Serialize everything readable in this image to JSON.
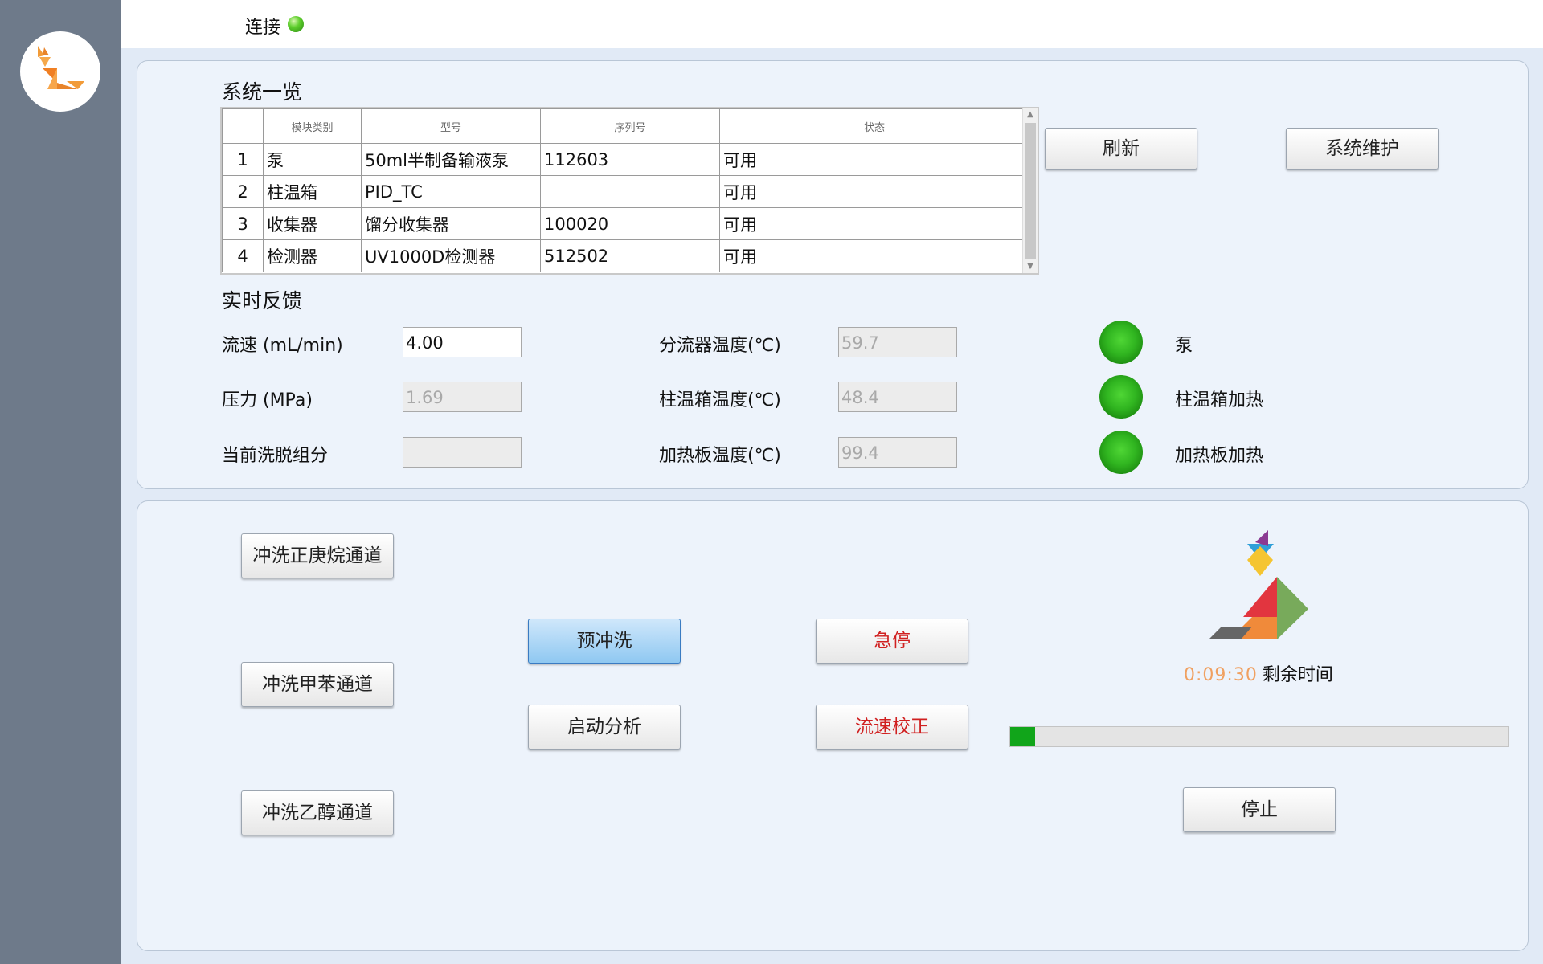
{
  "header": {
    "connection_label": "连接",
    "connection_status": "connected",
    "connection_color": "#44c028"
  },
  "overview": {
    "title": "系统一览",
    "columns": [
      "",
      "模块类别",
      "型号",
      "序列号",
      "状态"
    ],
    "rows": [
      {
        "index": "1",
        "category": "泵",
        "model": "50ml半制备输液泵",
        "serial": "112603",
        "status": "可用"
      },
      {
        "index": "2",
        "category": "柱温箱",
        "model": "PID_TC",
        "serial": "",
        "status": "可用"
      },
      {
        "index": "3",
        "category": "收集器",
        "model": "馏分收集器",
        "serial": "100020",
        "status": "可用"
      },
      {
        "index": "4",
        "category": "检测器",
        "model": "UV1000D检测器",
        "serial": "512502",
        "status": "可用"
      }
    ],
    "refresh_label": "刷新",
    "maintenance_label": "系统维护"
  },
  "feedback": {
    "title": "实时反馈",
    "flow_label": "流速 (mL/min)",
    "flow_value": "4.00",
    "pressure_label": "压力 (MPa)",
    "pressure_value": "1.69",
    "fraction_label": "当前洗脱组分",
    "fraction_value": "",
    "splitter_temp_label": "分流器温度(℃)",
    "splitter_temp_value": "59.7",
    "column_temp_label": "柱温箱温度(℃)",
    "column_temp_value": "48.4",
    "plate_temp_label": "加热板温度(℃)",
    "plate_temp_value": "99.4",
    "indicators": [
      {
        "label": "泵",
        "state": "on"
      },
      {
        "label": "柱温箱加热",
        "state": "on"
      },
      {
        "label": "加热板加热",
        "state": "on"
      }
    ],
    "indicator_color": "#33b523"
  },
  "controls": {
    "flush_hexane": "冲洗正庚烷通道",
    "flush_toluene": "冲洗甲苯通道",
    "flush_ethanol": "冲洗乙醇通道",
    "preflush": "预冲洗",
    "start_analysis": "启动分析",
    "emergency_stop": "急停",
    "flow_calibration": "流速校正",
    "stop": "停止",
    "remaining_time": "0:09:30",
    "remaining_label": "剩余时间",
    "progress": 0.05,
    "progress_color": "#11a51a",
    "alert_color": "#d02020"
  }
}
